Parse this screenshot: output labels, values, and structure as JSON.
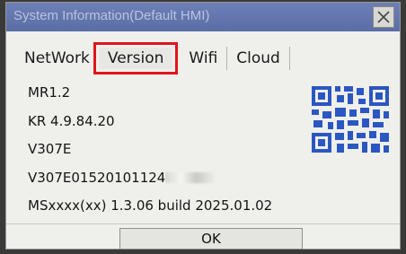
{
  "dialog": {
    "title": "System Information(Default HMI)",
    "close_icon": "close-icon",
    "ok_label": "OK"
  },
  "tabs": [
    {
      "label": "NetWork",
      "selected": false
    },
    {
      "label": "Version",
      "selected": true
    },
    {
      "label": "Wifi",
      "selected": false
    },
    {
      "label": "Cloud",
      "selected": false
    }
  ],
  "info": {
    "line1": "MR1.2",
    "line2": "KR 4.9.84.20",
    "line3": "V307E",
    "line4": "V307E01520101124",
    "line5": "MSxxxx(xx) 1.3.06 build 2025.01.02"
  },
  "qr_icon": "qr-code-icon",
  "colors": {
    "titlebar": "#5a6ea6",
    "highlight": "#e0141c",
    "qr": "#2b57c2"
  }
}
